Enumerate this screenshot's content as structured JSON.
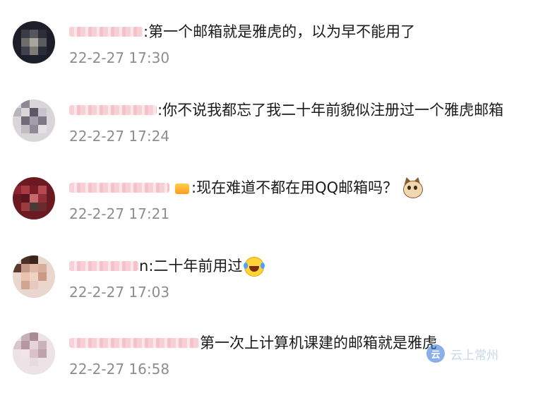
{
  "comments": [
    {
      "name_visible_suffix": "",
      "separator": ":",
      "text": "第一个邮箱就是雅虎的，以为早不能用了",
      "time": "22-2-27 17:30",
      "emoji_after": null
    },
    {
      "name_visible_suffix": "",
      "separator": ":",
      "text": "你不说我都忘了我二十年前貌似注册过一个雅虎邮箱",
      "time": "22-2-27 17:24",
      "emoji_after": null
    },
    {
      "name_visible_suffix": "",
      "separator": ":",
      "text": "现在难道不都在用QQ邮箱吗？",
      "time": "22-2-27 17:21",
      "badge_icon": "vip-crown-icon",
      "emoji_after": "cat-face-icon"
    },
    {
      "name_visible_suffix": "n",
      "separator": ":",
      "text": "二十年前用过",
      "time": "22-2-27 17:03",
      "emoji_after": "laughing-tears-icon"
    },
    {
      "name_visible_suffix": "",
      "separator": "",
      "text": "第一次上计算机课建的邮箱就是雅虎",
      "time": "22-2-27 16:58",
      "emoji_after": null
    }
  ],
  "watermark": {
    "badge": "云",
    "text": "云上常州"
  },
  "colors": {
    "text": "#1a1a1a",
    "time": "#8d8d8d",
    "background": "#ffffff"
  }
}
